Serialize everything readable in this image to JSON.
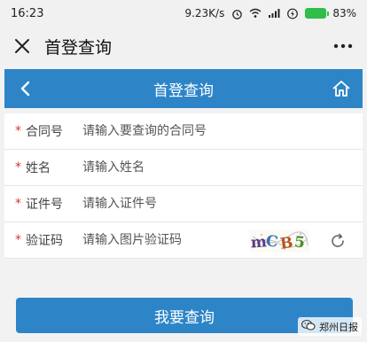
{
  "status_bar": {
    "time": "16:23",
    "network_speed": "9.23K/s",
    "battery": "83%",
    "battery_level": 0.83,
    "icons": [
      "alarm-icon",
      "wifi-icon",
      "signal-icon",
      "charging-icon",
      "battery-icon"
    ]
  },
  "app_header": {
    "close_icon": "close-icon",
    "title": "首登查询",
    "more_icon": "more-icon"
  },
  "blue_bar": {
    "back_icon": "back-arrow-icon",
    "title": "首登查询",
    "home_icon": "home-icon"
  },
  "form": {
    "required_mark": "*",
    "fields": [
      {
        "label": "合同号",
        "placeholder": "请输入要查询的合同号"
      },
      {
        "label": "姓名",
        "placeholder": "请输入姓名"
      },
      {
        "label": "证件号",
        "placeholder": "请输入证件号"
      },
      {
        "label": "验证码",
        "placeholder": "请输入图片验证码"
      }
    ],
    "captcha_text": "mCB5"
  },
  "submit_label": "我要查询",
  "watermark": "郑州日报",
  "colors": {
    "accent": "#2d85c8",
    "required": "#dd3333",
    "battery": "#2fbe4a"
  }
}
